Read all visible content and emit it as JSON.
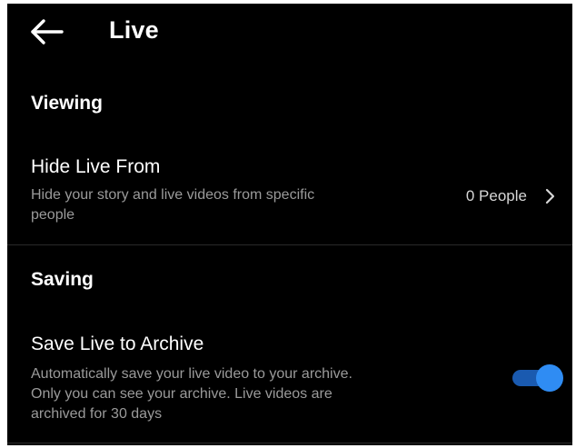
{
  "header": {
    "back_icon": "arrow-left-icon",
    "title": "Live"
  },
  "viewing": {
    "heading": "Viewing",
    "hide_live": {
      "title": "Hide Live From",
      "subtitle_line1": "Hide your story and live videos from specific",
      "subtitle_line2": "people",
      "value": "0 People",
      "icon": "chevron-right-icon"
    }
  },
  "saving": {
    "heading": "Saving",
    "archive": {
      "title": "Save Live to Archive",
      "subtitle_line1": "Automatically save your live video to your archive.",
      "subtitle_line2": "Only you can see your archive. Live videos are",
      "subtitle_line3": "archived for 30 days",
      "toggle_on": true
    }
  },
  "colors": {
    "background": "#000000",
    "text": "#ffffff",
    "secondary_text": "#9a9a9a",
    "toggle_track": "#1a5ab0",
    "toggle_knob": "#2f8cf3"
  }
}
